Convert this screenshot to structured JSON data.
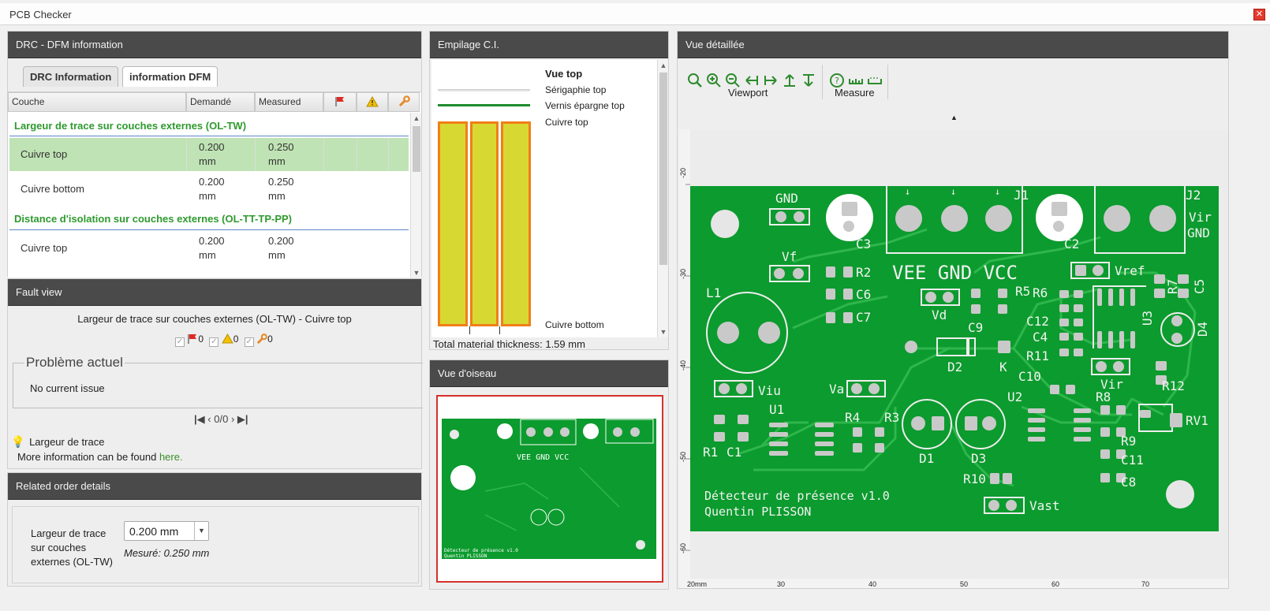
{
  "window": {
    "title": "PCB Checker",
    "close_glyph": "✕"
  },
  "drc": {
    "title": "DRC - DFM information",
    "tabs": [
      {
        "label": "DRC Information"
      },
      {
        "label": "information DFM"
      }
    ],
    "columns": {
      "layer": "Couche",
      "required": "Demandé",
      "measured": "Measured"
    },
    "groups": [
      {
        "title": "Largeur de trace sur couches externes (OL-TW)",
        "rows": [
          {
            "layer": "Cuivre top",
            "req1": "0.200",
            "req2": "mm",
            "meas1": "0.250",
            "meas2": "mm",
            "selected": true
          },
          {
            "layer": "Cuivre bottom",
            "req1": "0.200",
            "req2": "mm",
            "meas1": "0.250",
            "meas2": "mm",
            "selected": false
          }
        ]
      },
      {
        "title": "Distance d'isolation sur couches externes (OL-TT-TP-PP)",
        "rows": [
          {
            "layer": "Cuivre top",
            "req1": "0.200",
            "req2": "mm",
            "meas1": "0.200",
            "meas2": "mm",
            "selected": false
          }
        ]
      }
    ]
  },
  "fault": {
    "title": "Fault view",
    "subtitle": "Largeur de trace sur couches externes (OL-TW) - Cuivre top",
    "counts": {
      "flag": "0",
      "warning": "0",
      "fix": "0"
    },
    "current_issue_legend": "Problème actuel",
    "current_issue_text": "No current issue",
    "pager": "0/0",
    "hint_title": "Largeur de trace",
    "hint_text": "More information can be found ",
    "hint_link": "here."
  },
  "order": {
    "title": "Related order details",
    "label": "Largeur de trace sur couches externes (OL-TW)",
    "select_value": "0.200 mm",
    "measured": "Mesuré: 0.250 mm"
  },
  "stack": {
    "title": "Empilage C.I.",
    "labels": {
      "top": "Vue top",
      "silk": "Sérigaphie top",
      "mask": "Vernis épargne top",
      "copper_top": "Cuivre top",
      "copper_bottom": "Cuivre bottom"
    },
    "thickness": "Total material thickness: 1.59 mm"
  },
  "bird": {
    "title": "Vue d'oiseau"
  },
  "detail": {
    "title": "Vue détaillée",
    "groups": {
      "viewport": "Viewport",
      "measure": "Measure"
    },
    "y_ticks": [
      "-20",
      "-30",
      "-40",
      "-50",
      "-60"
    ],
    "x_ticks": [
      "20mm",
      "30",
      "40",
      "50",
      "60",
      "70"
    ],
    "board_text": {
      "line1": "Détecteur de présence v1.0",
      "line2": "Quentin PLISSON"
    },
    "refs": {
      "gnd": "GND",
      "vf": "Vf",
      "l1": "L1",
      "viu": "Viu",
      "r1": "R1",
      "c1": "C1",
      "u1": "U1",
      "va": "Va",
      "r4": "R4",
      "r3": "R3",
      "d1": "D1",
      "d3": "D3",
      "r10": "R10",
      "vast": "Vast",
      "c3": "C3",
      "r2": "R2",
      "c6": "C6",
      "c7": "C7",
      "vee": "VEE GND VCC",
      "vd": "Vd",
      "c9": "C9",
      "r5": "R5",
      "d2": "D2",
      "k": "K",
      "c10": "C10",
      "u2": "U2",
      "j1": "J1",
      "c2": "C2",
      "j2": "J2",
      "vir": "Vir",
      "gnd2": "GND",
      "r6": "R6",
      "c12": "C12",
      "c4": "C4",
      "r11": "R11",
      "vref": "Vref",
      "r7": "R7",
      "c5": "C5",
      "u3": "U3",
      "d4": "D4",
      "vir2": "Vir",
      "r12": "R12",
      "r8": "R8",
      "rv1": "RV1",
      "r9": "R9",
      "c11": "C11",
      "c8": "C8"
    }
  }
}
